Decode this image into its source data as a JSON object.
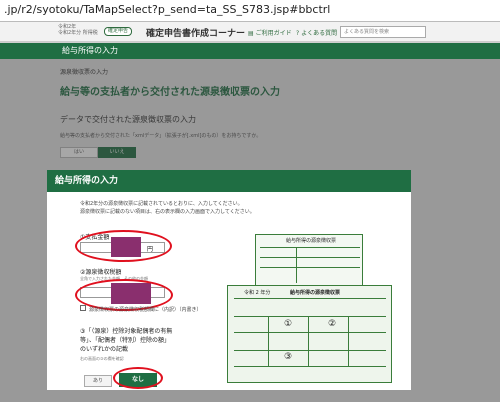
{
  "browser": {
    "url": ".jp/r2/syotoku/TaMapSelect?p_send=ta_SS_S783.jsp#bbctrl"
  },
  "header": {
    "era_line1": "令和2年",
    "era_line2": "令和2年分 所得税",
    "badge": "確定申告",
    "app_title": "確定申告書作成コーナー",
    "link_help": "ご利用ガイド",
    "link_faq": "よくある質問",
    "search_placeholder": "よくある質問を検索"
  },
  "nav": {
    "title": "給与所得の入力"
  },
  "page": {
    "subheading": "源泉徴収票の入力",
    "title": "給与等の支払者から交付された源泉徴収票の入力",
    "section_title": "データで交付された源泉徴収票の入力",
    "prompt": "給与等の支払者から交付された「xmlデータ」（拡張子が[.xml]のもの）をお持ちですか。",
    "yes_label": "はい",
    "no_label": "いいえ"
  },
  "modal": {
    "title": "給与所得の入力",
    "intro1": "令和2年分の源泉徴収票に記載されているとおりに、入力してください。",
    "intro2": "源泉徴収票に記載のない項目は、右の表示欄の入力画面で入力してください。",
    "field1_label": "①支払金額",
    "field1_unit": "円",
    "field2_label": "②源泉徴収税額",
    "field2_hint": "全角で入力された金額　その他の金額",
    "checkbox_label": "源泉徴収票の源泉徴収税額欄に（内訳）（内書き）",
    "note1": "③「（源泉）控除対象配偶者の有無",
    "note2": "等」、「配偶者（特別）控除の額」",
    "note3": "のいずれかの記載",
    "note_hint": "右の画面の③の欄を確認",
    "btn_ari": "あり",
    "btn_nashi": "なし"
  },
  "docs": {
    "doc1_title": "給与所得の源泉徴収票",
    "doc2_title": "給与所得の源泉徴収票",
    "doc2_year": "令和 2 年分",
    "marker1": "①",
    "marker2": "②",
    "marker3": "③"
  },
  "colors": {
    "brand_green": "#1f6e43",
    "highlight_red": "#e0101e",
    "redact_purple": "#8a2f6e"
  }
}
